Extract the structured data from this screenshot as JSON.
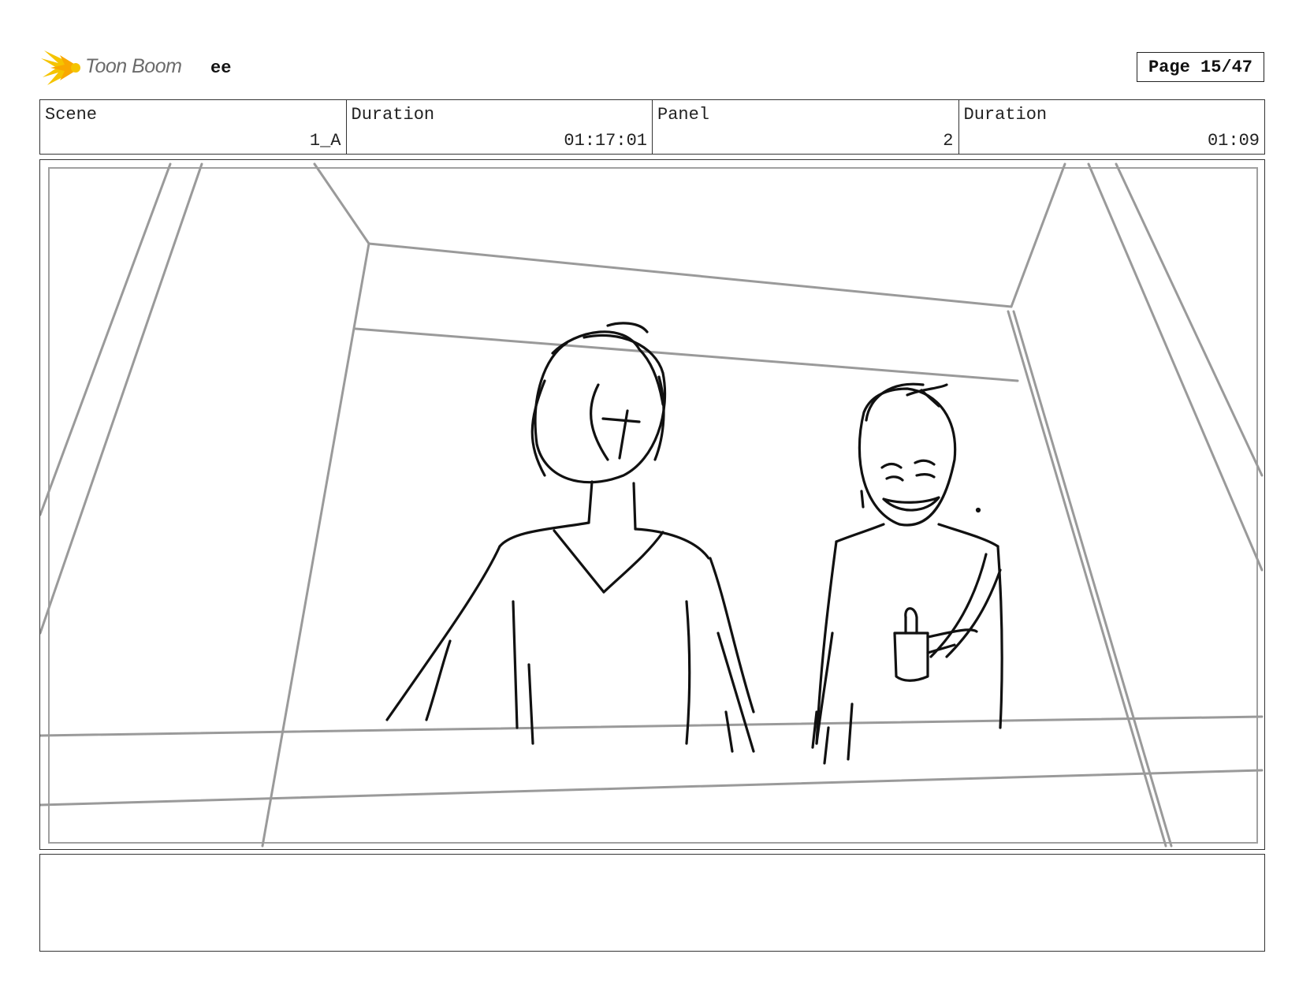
{
  "header": {
    "brand": "Toon Boom",
    "project_title": "ee",
    "page_label": "Page 15/47"
  },
  "info": {
    "scene_label": "Scene",
    "scene_value": "1_A",
    "scene_duration_label": "Duration",
    "scene_duration_value": "01:17:01",
    "panel_label": "Panel",
    "panel_value": "2",
    "panel_duration_label": "Duration",
    "panel_duration_value": "01:09"
  },
  "notes": {
    "text": ""
  },
  "colors": {
    "logo_yellow": "#f5c400",
    "perspective_gray": "#9a9a9a",
    "ink": "#111111"
  }
}
